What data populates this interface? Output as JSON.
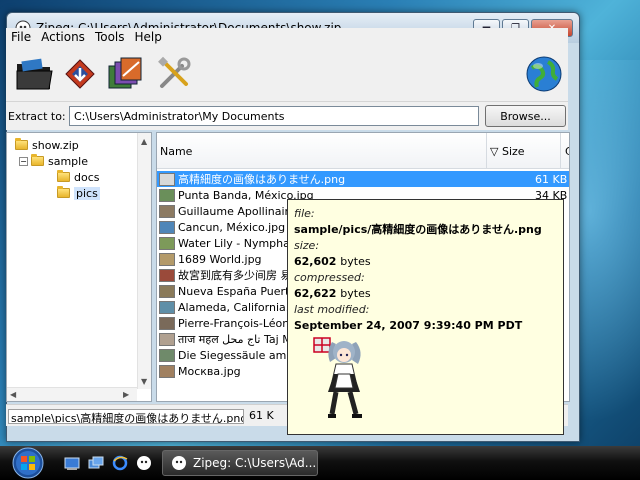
{
  "window": {
    "title": "Zipeg: C:\\Users\\Administrator\\Documents\\show.zip",
    "controls": {
      "minimize": "▬",
      "maximize": "❐",
      "close": "✕"
    }
  },
  "menu": [
    "File",
    "Actions",
    "Tools",
    "Help"
  ],
  "toolbar": {
    "icons": [
      "open-archive-icon",
      "extract-icon",
      "extract-all-icon",
      "options-icon",
      "web-globe-icon"
    ]
  },
  "extract": {
    "label": "Extract to:",
    "path": "C:\\Users\\Administrator\\My Documents",
    "browse_label": "Browse..."
  },
  "tree": [
    {
      "label": "show.zip",
      "level": 0,
      "expandable": false
    },
    {
      "label": "sample",
      "level": 1,
      "expandable": true,
      "expander": "−"
    },
    {
      "label": "docs",
      "level": 2,
      "expandable": false
    },
    {
      "label": "pics",
      "level": 2,
      "expandable": false,
      "selected": true
    }
  ],
  "list": {
    "columns": {
      "name": "Name",
      "size": "Size",
      "extra": "C"
    },
    "sort_indicator": "▽",
    "rows": [
      {
        "name": "高精細度の画像はありません.png",
        "size": "61 KB",
        "selected": true
      },
      {
        "name": "Punta Banda, México.jpg",
        "size": "34 KB"
      },
      {
        "name": "Guillaume Apollinaire, H",
        "size": ""
      },
      {
        "name": "Cancun, México.jpg",
        "size": ""
      },
      {
        "name": "Water Lily - Nymphaea",
        "size": ""
      },
      {
        "name": "1689 World.jpg",
        "size": ""
      },
      {
        "name": "故宮到底有多少间房 易",
        "size": ""
      },
      {
        "name": "Nueva España Puerto d",
        "size": ""
      },
      {
        "name": "Alameda, California.jpg",
        "size": ""
      },
      {
        "name": "Pierre-François-Léonar",
        "size": ""
      },
      {
        "name": "ताज महल تاج محل Taj Ma",
        "size": ""
      },
      {
        "name": "Die Siegessäule am Gro",
        "size": ""
      },
      {
        "name": "Москва.jpg",
        "size": ""
      }
    ]
  },
  "tooltip": {
    "file_label": "file:",
    "file_value": "sample/pics/高精細度の画像はありません.png",
    "size_label": "size:",
    "size_value": "62,602",
    "size_unit": "bytes",
    "compressed_label": "compressed:",
    "compressed_value": "62,622",
    "compressed_unit": "bytes",
    "modified_label": "last modified:",
    "modified_value": "September 24, 2007 9:39:40 PM PDT"
  },
  "status": {
    "path": "sample\\pics\\高精細度の画像はありません.png",
    "size": "61 K"
  },
  "taskbar": {
    "task_label": "Zipeg: C:\\Users\\Ad..."
  },
  "colors": {
    "selection": "#3399ff",
    "tooltip_bg": "#ffffe1",
    "taskbar": "#101010"
  }
}
